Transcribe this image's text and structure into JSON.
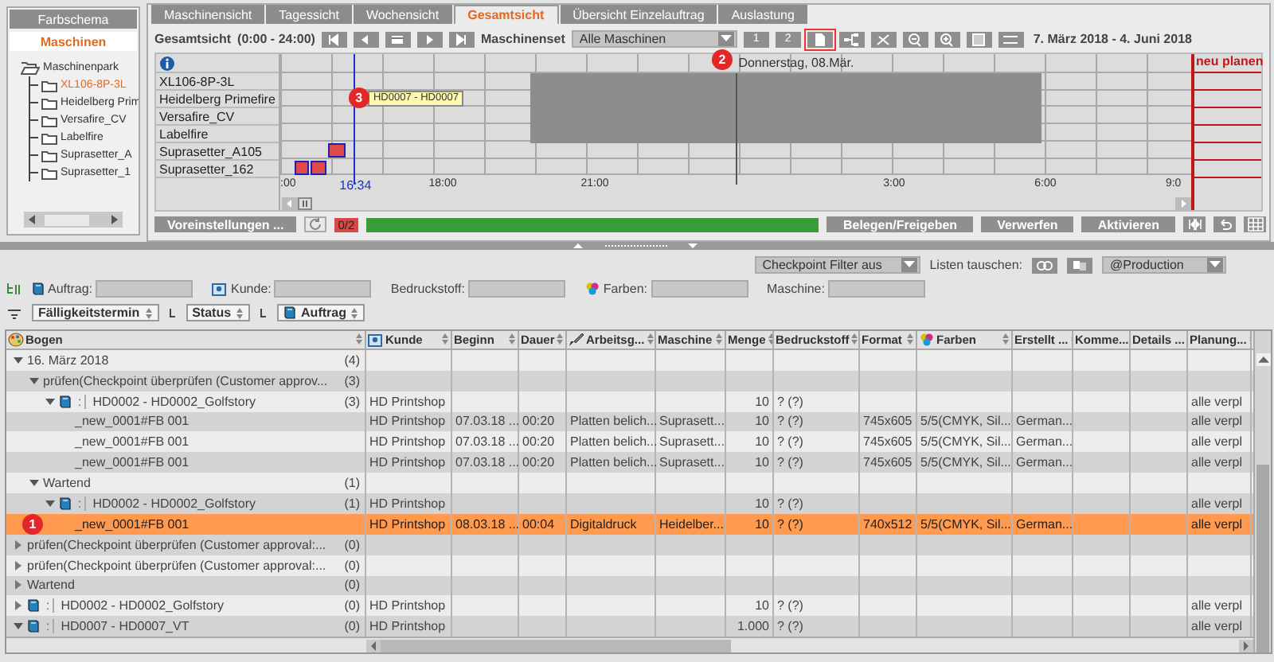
{
  "sidebar": {
    "tabs": [
      {
        "label": "Farbschema",
        "selected": false
      },
      {
        "label": "Maschinen",
        "selected": true
      }
    ],
    "tree": {
      "label": "Maschinenpark",
      "expanded": true,
      "children": [
        {
          "label": "XL106-8P-3L",
          "selected": true
        },
        {
          "label": "Heidelberg Prim",
          "selected": false
        },
        {
          "label": "Versafire_CV",
          "selected": false
        },
        {
          "label": "Labelfire",
          "selected": false
        },
        {
          "label": "Suprasetter_A",
          "selected": false
        },
        {
          "label": "Suprasetter_1",
          "selected": false
        }
      ]
    }
  },
  "view_tabs": [
    {
      "label": "Maschinensicht",
      "selected": false
    },
    {
      "label": "Tagessicht",
      "selected": false
    },
    {
      "label": "Wochensicht",
      "selected": false
    },
    {
      "label": "Gesamtsicht",
      "selected": true
    },
    {
      "label": "Übersicht Einzelauftrag",
      "selected": false
    },
    {
      "label": "Auslastung",
      "selected": false
    }
  ],
  "toolbar": {
    "view_label": "Gesamtsicht",
    "range": "(0:00 - 24:00)",
    "machine_set_label": "Maschinenset",
    "machine_set": "Alle Maschinen",
    "page_buttons": [
      "1",
      "2"
    ],
    "callout": "2",
    "date_range": "7. März 2018  -  4. Juni 2018"
  },
  "gantt": {
    "day_label": "Donnerstag, 08.Mär.",
    "replan_label": "neu planen",
    "current_time": "16:34",
    "machines": [
      {
        "name": "XL106-8P-3L"
      },
      {
        "name": "Heidelberg Primefire",
        "tooltip": {
          "text": "HD0007 - HD0007",
          "callout": "3"
        }
      },
      {
        "name": "Versafire_CV"
      },
      {
        "name": "Labelfire"
      },
      {
        "name": "Suprasetter_A105",
        "jobs": [
          {
            "kind": "block"
          }
        ]
      },
      {
        "name": "Suprasetter_162",
        "jobs": [
          {
            "kind": "block"
          },
          {
            "kind": "block"
          }
        ]
      }
    ],
    "time_labels": [
      ":00",
      "18:00",
      "21:00",
      "3:00",
      "6:00",
      "9:0"
    ]
  },
  "actions": {
    "presets": "Voreinstellungen ...",
    "counter": "0/2",
    "progress": {
      "level": 1
    },
    "buttons": [
      "Belegen/Freigeben",
      "Verwerfen",
      "Aktivieren"
    ]
  },
  "filters": {
    "checkpoint": "Checkpoint Filter aus",
    "swap_label": "Listen tauschen:",
    "profile": "@Production",
    "fields": [
      {
        "kind": "order",
        "label": "Auftrag:"
      },
      {
        "kind": "customer",
        "label": "Kunde:"
      },
      {
        "kind": "plain",
        "label": "Bedruckstoff:"
      },
      {
        "kind": "colors",
        "label": "Farben:"
      },
      {
        "kind": "plain",
        "label": "Maschine:"
      }
    ],
    "sort": [
      {
        "kind": "plain",
        "label": "Fälligkeitstermin"
      },
      {
        "kind": "plain",
        "label": "Status"
      },
      {
        "kind": "order",
        "label": "Auftrag"
      }
    ]
  },
  "table": {
    "columns": [
      {
        "kind": "palette",
        "label": "Bogen"
      },
      {
        "kind": "customer",
        "label": "Kunde"
      },
      {
        "kind": "plain",
        "label": "Beginn"
      },
      {
        "kind": "plain",
        "label": "Dauer"
      },
      {
        "kind": "brush",
        "label": "Arbeitsg..."
      },
      {
        "kind": "plain",
        "label": "Maschine"
      },
      {
        "kind": "plain",
        "label": "Menge"
      },
      {
        "kind": "plain",
        "label": "Bedruckstoff"
      },
      {
        "kind": "plain",
        "label": "Format"
      },
      {
        "kind": "colors",
        "label": "Farben"
      },
      {
        "kind": "plain",
        "label": "Erstellt ..."
      },
      {
        "kind": "plain",
        "label": "Komme..."
      },
      {
        "kind": "plain",
        "label": "Details ..."
      },
      {
        "kind": "plain",
        "label": "Planung..."
      }
    ],
    "rows": [
      {
        "kind": "group",
        "label": "16. März 2018",
        "count": "(4)",
        "expanded": true,
        "selected": false,
        "children": [
          {
            "kind": "group",
            "label": "prüfen(Checkpoint überprüfen (Customer approv...",
            "count": "(3)",
            "expanded": true,
            "selected": false,
            "children": [
              {
                "kind": "job",
                "separator": ":",
                "label": "HD0002 - HD0002_Golfstory",
                "count": "(3)",
                "expanded": true,
                "selected": false,
                "cells": [
                  "HD Printshop",
                  null,
                  null,
                  null,
                  null,
                  "10",
                  "? (?)",
                  null,
                  null,
                  null,
                  null,
                  null,
                  "alle verpl"
                ],
                "children": [
                  {
                    "kind": "sheet",
                    "label": "_new_0001#FB 001",
                    "selected": false,
                    "cells": [
                      "HD Printshop",
                      "07.03.18 ...",
                      "00:20",
                      "Platten belich...",
                      "Suprasett...",
                      "10",
                      "? (?)",
                      "745x605",
                      "5/5(CMYK, Sil...",
                      "German...",
                      null,
                      null,
                      "alle verpl"
                    ]
                  },
                  {
                    "kind": "sheet",
                    "label": "_new_0001#FB 001",
                    "selected": false,
                    "cells": [
                      "HD Printshop",
                      "07.03.18 ...",
                      "00:20",
                      "Platten belich...",
                      "Suprasett...",
                      "10",
                      "? (?)",
                      "745x605",
                      "5/5(CMYK, Sil...",
                      "German...",
                      null,
                      null,
                      "alle verpl"
                    ]
                  },
                  {
                    "kind": "sheet",
                    "label": "_new_0001#FB 001",
                    "selected": false,
                    "cells": [
                      "HD Printshop",
                      "07.03.18 ...",
                      "00:20",
                      "Platten belich...",
                      "Suprasett...",
                      "10",
                      "? (?)",
                      "745x605",
                      "5/5(CMYK, Sil...",
                      "German...",
                      null,
                      null,
                      "alle verpl"
                    ]
                  }
                ]
              }
            ]
          },
          {
            "kind": "group",
            "label": "Wartend",
            "count": "(1)",
            "expanded": true,
            "selected": false,
            "children": [
              {
                "kind": "job",
                "separator": ":",
                "label": "HD0002 - HD0002_Golfstory",
                "count": "(1)",
                "expanded": true,
                "selected": false,
                "cells": [
                  "HD Printshop",
                  null,
                  null,
                  null,
                  null,
                  "10",
                  "? (?)",
                  null,
                  null,
                  null,
                  null,
                  null,
                  "alle verpl"
                ],
                "children": [
                  {
                    "kind": "sheet",
                    "label": "_new_0001#FB 001",
                    "selected": true,
                    "callout": "1",
                    "cells": [
                      "HD Printshop",
                      "08.03.18 ...",
                      "00:04",
                      "Digitaldruck",
                      "Heidelber...",
                      "10",
                      "? (?)",
                      "740x512",
                      "5/5(CMYK, Sil...",
                      "German...",
                      null,
                      null,
                      "alle verpl"
                    ]
                  }
                ]
              }
            ]
          }
        ]
      },
      {
        "kind": "group",
        "label": "prüfen(Checkpoint überprüfen (Customer approval:...",
        "count": "(0)",
        "expanded": false,
        "selected": false
      },
      {
        "kind": "group",
        "label": "prüfen(Checkpoint überprüfen (Customer approval:...",
        "count": "(0)",
        "expanded": false,
        "selected": false
      },
      {
        "kind": "group",
        "label": "Wartend",
        "count": "(0)",
        "expanded": false,
        "selected": false
      },
      {
        "kind": "job",
        "separator": ":",
        "label": "HD0002 - HD0002_Golfstory",
        "count": "(0)",
        "expanded": false,
        "selected": false,
        "cells": [
          "HD Printshop",
          null,
          null,
          null,
          null,
          "10",
          "? (?)",
          null,
          null,
          null,
          null,
          null,
          "alle verpl"
        ]
      },
      {
        "kind": "job",
        "separator": ":",
        "label": "HD0007 - HD0007_VT",
        "count": "(0)",
        "expanded": true,
        "selected": false,
        "cells": [
          "HD Printshop",
          null,
          null,
          null,
          null,
          "1.000",
          "? (?)",
          null,
          null,
          null,
          null,
          null,
          "alle verpl"
        ]
      }
    ]
  }
}
